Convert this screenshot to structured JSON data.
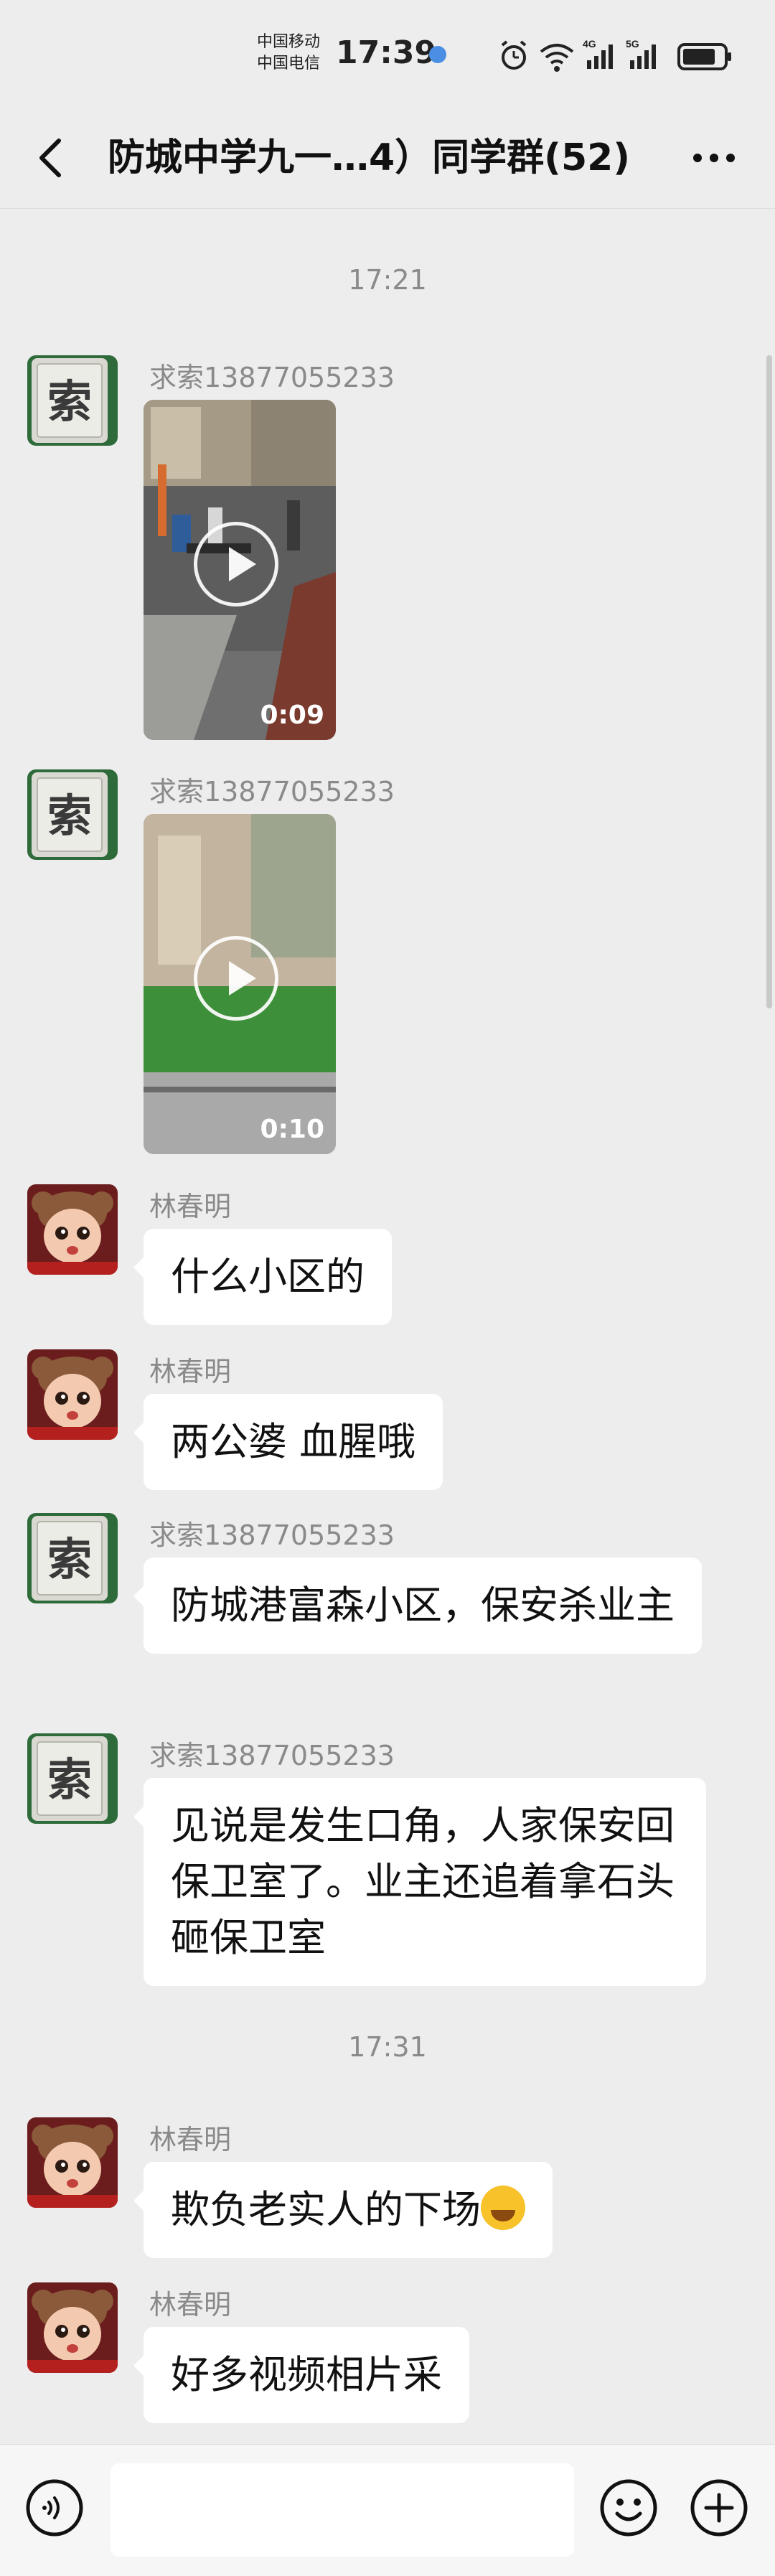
{
  "status_bar": {
    "carrier_1": "中国移动",
    "carrier_2": "中国电信",
    "time": "17:39",
    "network_1": "4G",
    "network_2": "5G"
  },
  "header": {
    "title": "防城中学九一…4）同学群(52)"
  },
  "chat": {
    "timestamps": [
      "17:21",
      "17:31"
    ],
    "messages": [
      {
        "sender": "求索13877055233",
        "type": "video",
        "duration": "0:09",
        "avatar": "tile-avatar"
      },
      {
        "sender": "求索13877055233",
        "type": "video",
        "duration": "0:10",
        "avatar": "tile-avatar"
      },
      {
        "sender": "林春明",
        "type": "text",
        "text": "什么小区的",
        "avatar": "baby-avatar"
      },
      {
        "sender": "林春明",
        "type": "text",
        "text": "两公婆 血腥哦",
        "avatar": "baby-avatar"
      },
      {
        "sender": "求索13877055233",
        "type": "text",
        "text": "防城港富森小区，保安杀业主",
        "avatar": "tile-avatar"
      },
      {
        "sender": "求索13877055233",
        "type": "text",
        "text": "见说是发生口角，人家保安回保卫室了。业主还追着拿石头砸保卫室",
        "avatar": "tile-avatar"
      },
      {
        "sender": "林春明",
        "type": "text",
        "text": "欺负老实人的下场",
        "emoji": "laughing-crying-emoji",
        "avatar": "baby-avatar"
      },
      {
        "sender": "林春明",
        "type": "text",
        "text": "好多视频相片采",
        "avatar": "baby-avatar"
      }
    ]
  },
  "input_bar": {
    "voice_icon": "voice-icon",
    "emoji_icon": "emoji-icon",
    "plus_icon": "plus-icon"
  },
  "colors": {
    "background": "#ededed",
    "bubble": "#ffffff",
    "secondary_text": "#8a8a8a"
  }
}
